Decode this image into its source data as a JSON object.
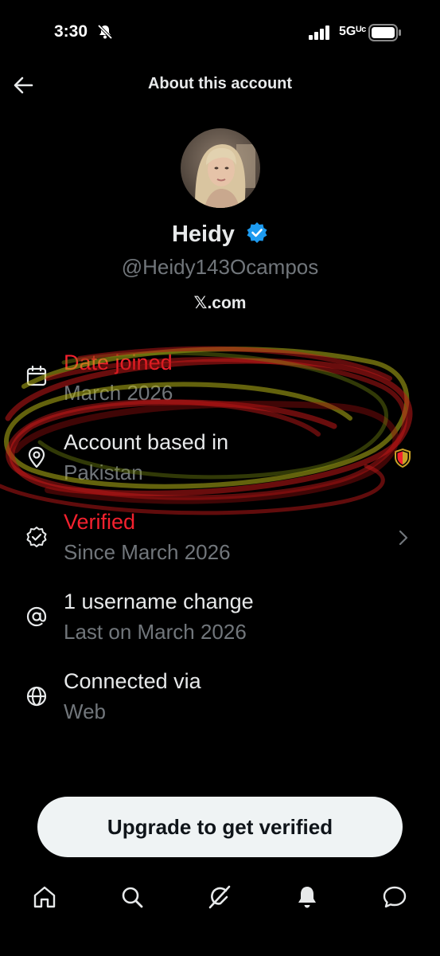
{
  "status_bar": {
    "time": "3:30",
    "network": "5Gᵁᶜ"
  },
  "header": {
    "title": "About this account"
  },
  "profile": {
    "name": "Heidy",
    "handle": "@Heidy143Ocampos",
    "site": "𝕏.com"
  },
  "info": {
    "date_joined": {
      "title": "Date joined",
      "subtitle": "March 2026"
    },
    "based_in": {
      "title": "Account based in",
      "subtitle": "Pakistan"
    },
    "verified": {
      "title": "Verified",
      "subtitle": "Since March 2026"
    },
    "username_changes": {
      "title": "1 username change",
      "subtitle": "Last on March 2026"
    },
    "connected": {
      "title": "Connected via",
      "subtitle": "Web"
    }
  },
  "cta": {
    "label": "Upgrade to get verified"
  },
  "colors": {
    "background": "#000000",
    "primary_text": "#e7e9ea",
    "secondary_text": "#71767b",
    "verified_blue": "#1d9bf0",
    "alert_red": "#f4212e",
    "shield_gold": "#c9a227",
    "button_bg": "#eff3f4"
  },
  "icons": {
    "status": [
      "bell-slash-icon",
      "signal-icon",
      "battery-icon"
    ],
    "header": [
      "back-arrow-icon"
    ],
    "info": [
      "calendar-icon",
      "location-pin-icon",
      "verified-check-icon",
      "at-sign-icon",
      "globe-icon",
      "shield-icon",
      "chevron-right-icon"
    ],
    "nav": [
      "home-icon",
      "search-icon",
      "grok-icon",
      "bell-icon",
      "chat-icon"
    ]
  }
}
